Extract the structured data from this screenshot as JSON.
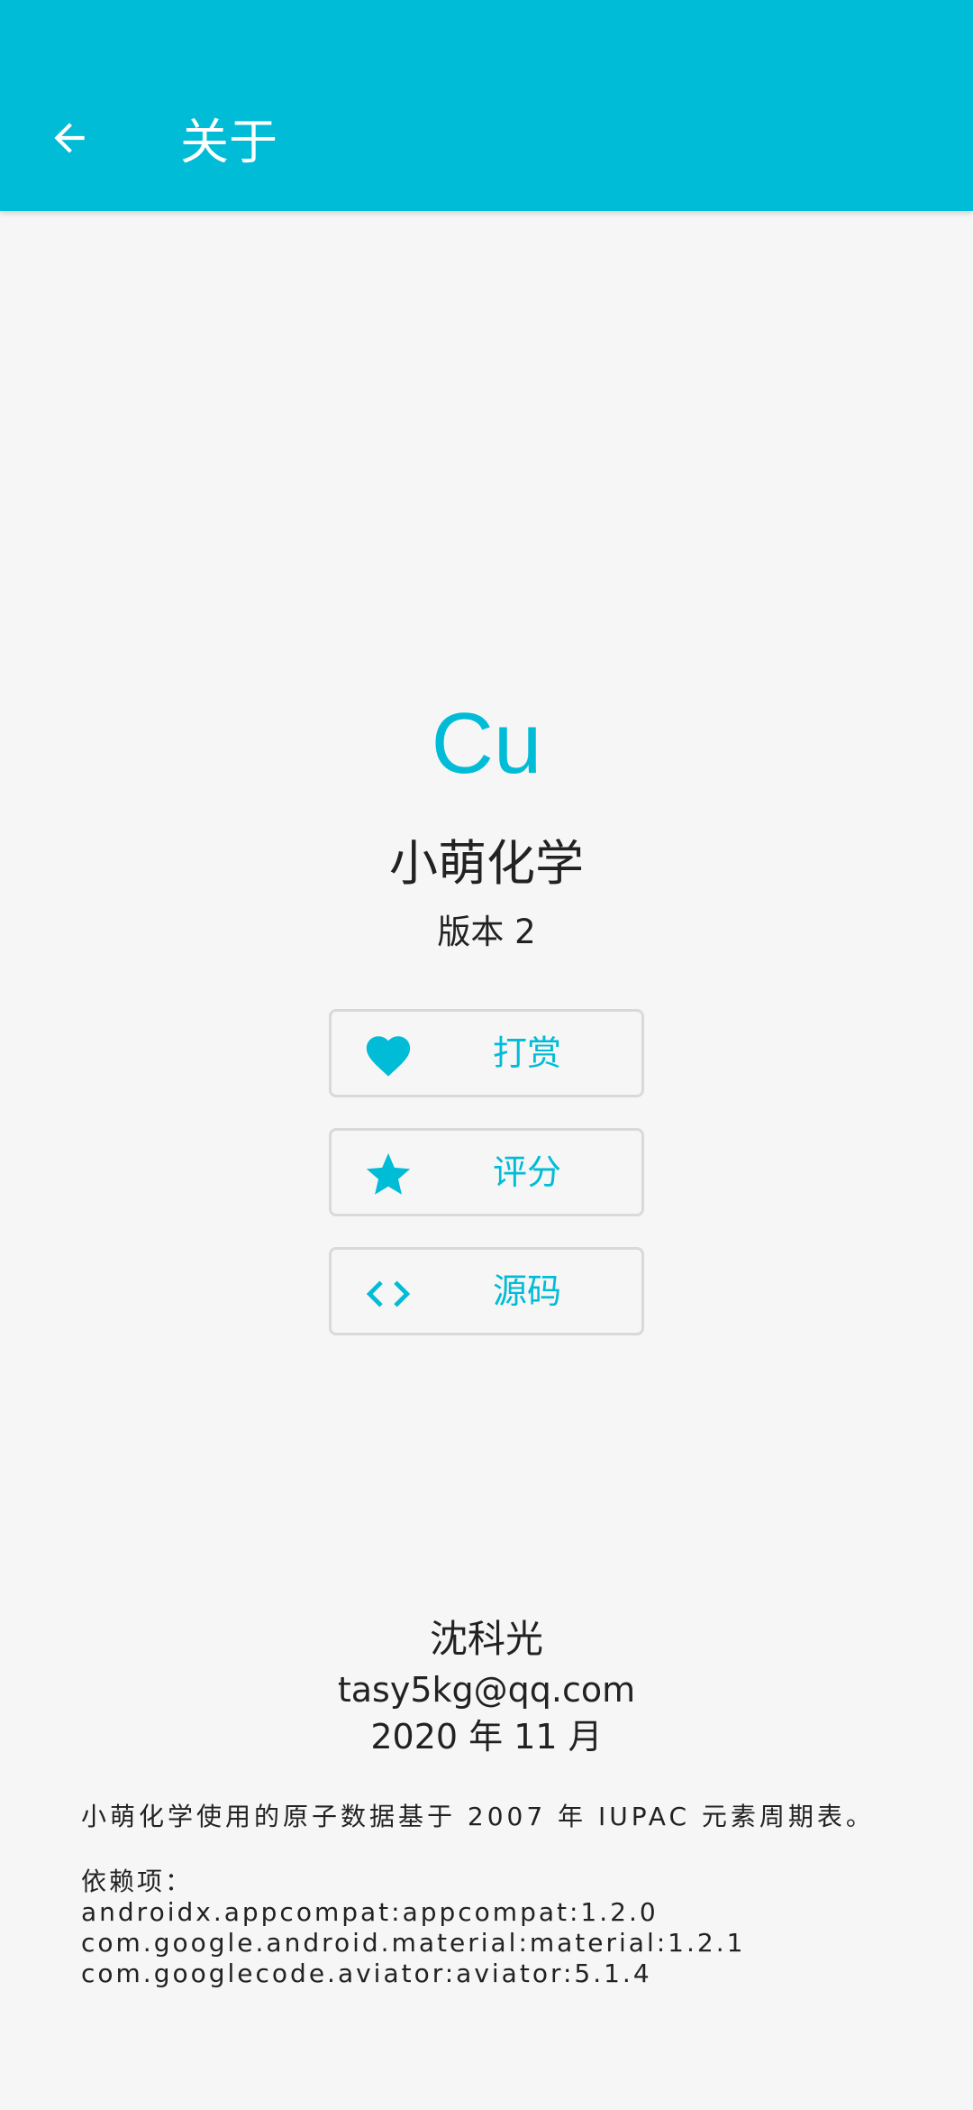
{
  "appbar": {
    "title": "关于",
    "back_icon": "arrow-left-icon",
    "background_color": "#01bcd6"
  },
  "logo": {
    "text": "Cu",
    "color": "#01bcd6"
  },
  "app": {
    "name": "小萌化学",
    "version": "版本 2"
  },
  "actions": [
    {
      "label": "打赏",
      "icon": "heart-icon"
    },
    {
      "label": "评分",
      "icon": "star-icon"
    },
    {
      "label": "源码",
      "icon": "code-brackets-icon"
    }
  ],
  "author": {
    "name": "沈科光",
    "email": "tasy5kg@qq.com",
    "date": "2020 年 11 月"
  },
  "notes": {
    "data_source": "小萌化学使用的原子数据基于 2007 年 IUPAC 元素周期表。",
    "dependencies_label": "依赖项：",
    "dependencies": [
      "androidx.appcompat:appcompat:1.2.0",
      "com.google.android.material:material:1.2.1",
      "com.googlecode.aviator:aviator:5.1.4"
    ]
  }
}
